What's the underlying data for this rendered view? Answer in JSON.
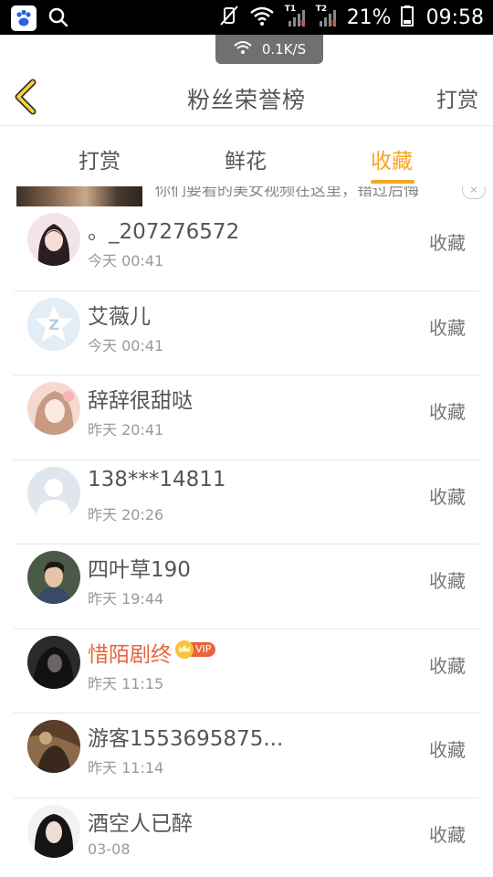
{
  "status_bar": {
    "battery_percent": "21%",
    "time": "09:58",
    "sim1": "T1",
    "sim2": "T2"
  },
  "net_speed": "0.1K/S",
  "header": {
    "title": "粉丝荣誉榜",
    "action_label": "打赏"
  },
  "tabs": [
    {
      "label": "打赏",
      "active": false
    },
    {
      "label": "鲜花",
      "active": false
    },
    {
      "label": "收藏",
      "active": true
    }
  ],
  "accent_color": "#f5a623",
  "banner": {
    "text": "你们要看的美女视频在这里，错过后悔",
    "close_label": "×"
  },
  "list": [
    {
      "name": "。_207276572",
      "time": "今天 00:41",
      "action": "收藏",
      "vip": false
    },
    {
      "name": "艾薇儿",
      "time": "今天 00:41",
      "action": "收藏",
      "vip": false
    },
    {
      "name": "辞辞很甜哒",
      "time": "昨天 20:41",
      "action": "收藏",
      "vip": false
    },
    {
      "name": "138***14811",
      "time": "昨天 20:26",
      "action": "收藏",
      "vip": false
    },
    {
      "name": "四叶草190",
      "time": "昨天 19:44",
      "action": "收藏",
      "vip": false
    },
    {
      "name": "惜陌剧终",
      "time": "昨天 11:15",
      "action": "收藏",
      "vip": true,
      "vip_label": "VIP"
    },
    {
      "name": "游客1553695875...",
      "time": "昨天 11:14",
      "action": "收藏",
      "vip": false
    },
    {
      "name": "酒空人已醉",
      "time": "03-08",
      "action": "收藏",
      "vip": false
    }
  ]
}
